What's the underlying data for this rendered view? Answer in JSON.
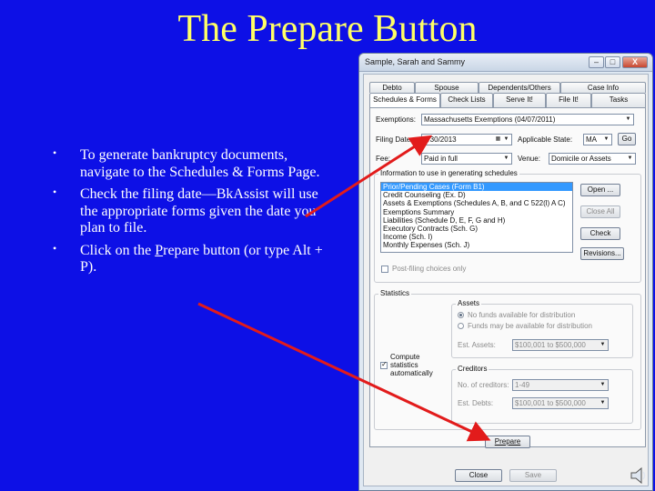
{
  "slide": {
    "title": "The Prepare Button",
    "bullets": [
      {
        "text": "To generate bankruptcy documents, navigate to the Schedules & Forms Page."
      },
      {
        "text": "Check the filing date—BkAssist will use the appropriate forms given the date you plan to file."
      },
      {
        "pre": "Click on the ",
        "accel": "P",
        "post": "repare button (or type Alt + P)."
      }
    ],
    "bullet_symbol": "•"
  },
  "window": {
    "title": "Sample, Sarah and Sammy",
    "controls": {
      "minimize": "–",
      "maximize": "□",
      "close": "X"
    },
    "tabs_row1": [
      "Debto",
      "Spouse",
      "Dependents/Others",
      "Case Info"
    ],
    "tabs_row2": [
      "Schedules & Forms",
      "Check Lists",
      "Serve It!",
      "File It!",
      "Tasks"
    ],
    "exemptions": {
      "label": "Exemptions:",
      "value": "Massachusetts Exemptions (04/07/2011)"
    },
    "filing_date": {
      "label": "Filing Date:",
      "value": "5/30/2013"
    },
    "applicable_state": {
      "label": "Applicable State:",
      "value": "MA",
      "goto": "Go"
    },
    "fee": {
      "label": "Fee:",
      "value": "Paid in full"
    },
    "venue": {
      "label": "Venue:",
      "value": "Domicile or Assets"
    },
    "info_group": {
      "title": "Information to use in generating schedules",
      "items": [
        "Prior/Pending Cases (Form B1)",
        "Credit Counseling (Ex. D)",
        "Assets & Exemptions (Schedules A, B, and C 522(l) A C)",
        "Exemptions Summary",
        "Liabilities (Schedule D, E, F, G and H)",
        "Executory Contracts (Sch. G)",
        "Income (Sch. I)",
        "Monthly Expenses (Sch. J)"
      ],
      "post_filing": "Post-filing choices only",
      "buttons": {
        "open": "Open ...",
        "close_all": "Close All",
        "check": "Check",
        "revisions": "Revisions..."
      }
    },
    "statistics": {
      "title": "Statistics",
      "compute_label": "Compute statistics automatically",
      "assets": {
        "title": "Assets",
        "radio1": "No funds available for distribution",
        "radio2": "Funds may be available for distribution",
        "est_label": "Est. Assets:",
        "est_value": "$100,001 to $500,000"
      },
      "creditors": {
        "title": "Creditors",
        "num_label": "No. of creditors:",
        "num_value": "1-49",
        "debts_label": "Est. Debts:",
        "debts_value": "$100,001 to $500,000"
      }
    },
    "prepare_button": "Prepare",
    "close_button": "Close",
    "save_button": "Save"
  },
  "colors": {
    "background": "#0d10e6",
    "title": "#ffff66",
    "bullet_text": "#ffffff",
    "arrow": "#e21b1b",
    "selection": "#3399ff"
  },
  "icons": [
    "speaker-icon",
    "bullet-icon",
    "dropdown-arrow-icon",
    "calendar-icon",
    "minimize-icon",
    "maximize-icon",
    "close-icon"
  ]
}
